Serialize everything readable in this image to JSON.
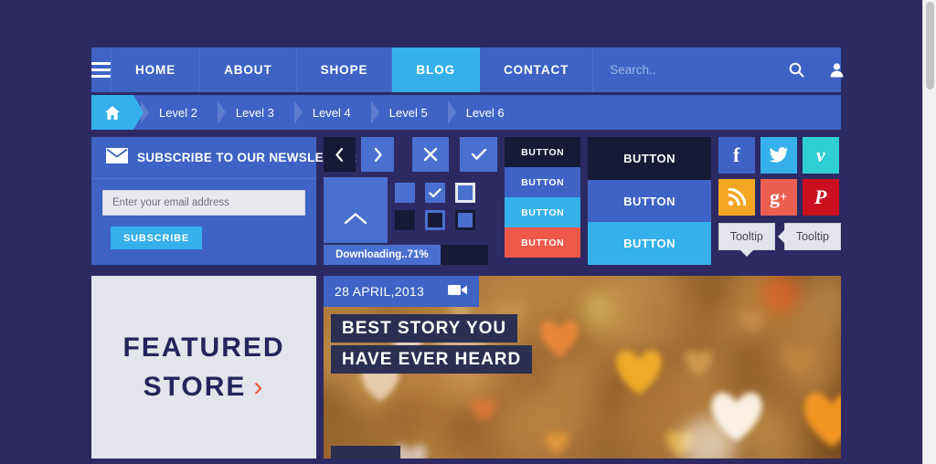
{
  "navbar": {
    "menu_icon": "hamburger-icon",
    "items": [
      {
        "label": "HOME",
        "active": false
      },
      {
        "label": "ABOUT",
        "active": false
      },
      {
        "label": "SHOPE",
        "active": false
      },
      {
        "label": "BLOG",
        "active": true
      },
      {
        "label": "CONTACT",
        "active": false
      }
    ],
    "search": {
      "placeholder": "Search..",
      "value": "",
      "search_icon": "search-icon",
      "user_icon": "user-icon"
    }
  },
  "breadcrumb": {
    "home_icon": "home-icon",
    "items": [
      {
        "label": "Level 2"
      },
      {
        "label": "Level 3"
      },
      {
        "label": "Level 4"
      },
      {
        "label": "Level 5"
      },
      {
        "label": "Level 6"
      }
    ]
  },
  "subscribe": {
    "mail_icon": "envelope-icon",
    "title": "SUBSCRIBE TO OUR NEWSLETTER",
    "input_placeholder": "Enter your email address",
    "input_value": "",
    "button_label": "SUBSCRIBE"
  },
  "controls": {
    "prev_icon": "chevron-left-icon",
    "next_icon": "chevron-right-icon",
    "close_icon": "close-x-icon",
    "check_icon": "check-icon",
    "up_icon": "chevron-up-icon",
    "checkboxes": [
      {
        "name": "checkbox-empty-blue",
        "checked": false
      },
      {
        "name": "checkbox-checked-blue",
        "checked": true
      },
      {
        "name": "checkbox-blue-light-border",
        "checked": false
      },
      {
        "name": "checkbox-empty-dark",
        "checked": false
      },
      {
        "name": "checkbox-dark-blue-border",
        "checked": false
      },
      {
        "name": "checkbox-blue-dark-border",
        "checked": false
      }
    ],
    "progress": {
      "label": "Downloading..71%",
      "percent": 71
    }
  },
  "buttons_small": [
    {
      "label": "BUTTON",
      "color": "#171a36",
      "variant": "dark"
    },
    {
      "label": "BUTTON",
      "color": "#3e63c4",
      "variant": "blue"
    },
    {
      "label": "BUTTON",
      "color": "#35b0ea",
      "variant": "cyan"
    },
    {
      "label": "BUTTON",
      "color": "#f0584a",
      "variant": "red"
    }
  ],
  "buttons_large": [
    {
      "label": "BUTTON",
      "color": "#171a36",
      "variant": "dark"
    },
    {
      "label": "BUTTON",
      "color": "#3e63c4",
      "variant": "blue"
    },
    {
      "label": "BUTTON",
      "color": "#35b0ea",
      "variant": "cyan"
    }
  ],
  "socials": [
    {
      "name": "facebook-icon",
      "glyph": "f",
      "color": "#3e63c4"
    },
    {
      "name": "twitter-icon",
      "glyph": "ᵕ",
      "color": "#35b0ea"
    },
    {
      "name": "vimeo-icon",
      "glyph": "v",
      "color": "#2ecfd4"
    },
    {
      "name": "rss-icon",
      "glyph": "◔",
      "color": "#f5a623"
    },
    {
      "name": "googleplus-icon",
      "glyph": "g+",
      "color": "#ea5f4f"
    },
    {
      "name": "pinterest-icon",
      "glyph": "P",
      "color": "#cc0f1f"
    }
  ],
  "tooltips": [
    {
      "label": "Tooltip",
      "arrow": "bottom"
    },
    {
      "label": "Tooltip",
      "arrow": "left"
    }
  ],
  "featured": {
    "line1": "FEATURED",
    "line2": "STORE",
    "chevron": "›"
  },
  "post": {
    "date": "28 APRIL,2013",
    "video_icon": "video-camera-icon",
    "title_line1": "BEST STORY YOU",
    "title_line2": "HAVE EVER HEARD"
  },
  "colors": {
    "page_background": "#2d2a63",
    "nav_blue": "#3e63c4",
    "accent_cyan": "#35b0ea",
    "dark": "#171a36",
    "red": "#f0584a",
    "light_panel": "#e4e4ec",
    "featured_text": "#24255c",
    "featured_chevron": "#f0563a"
  }
}
